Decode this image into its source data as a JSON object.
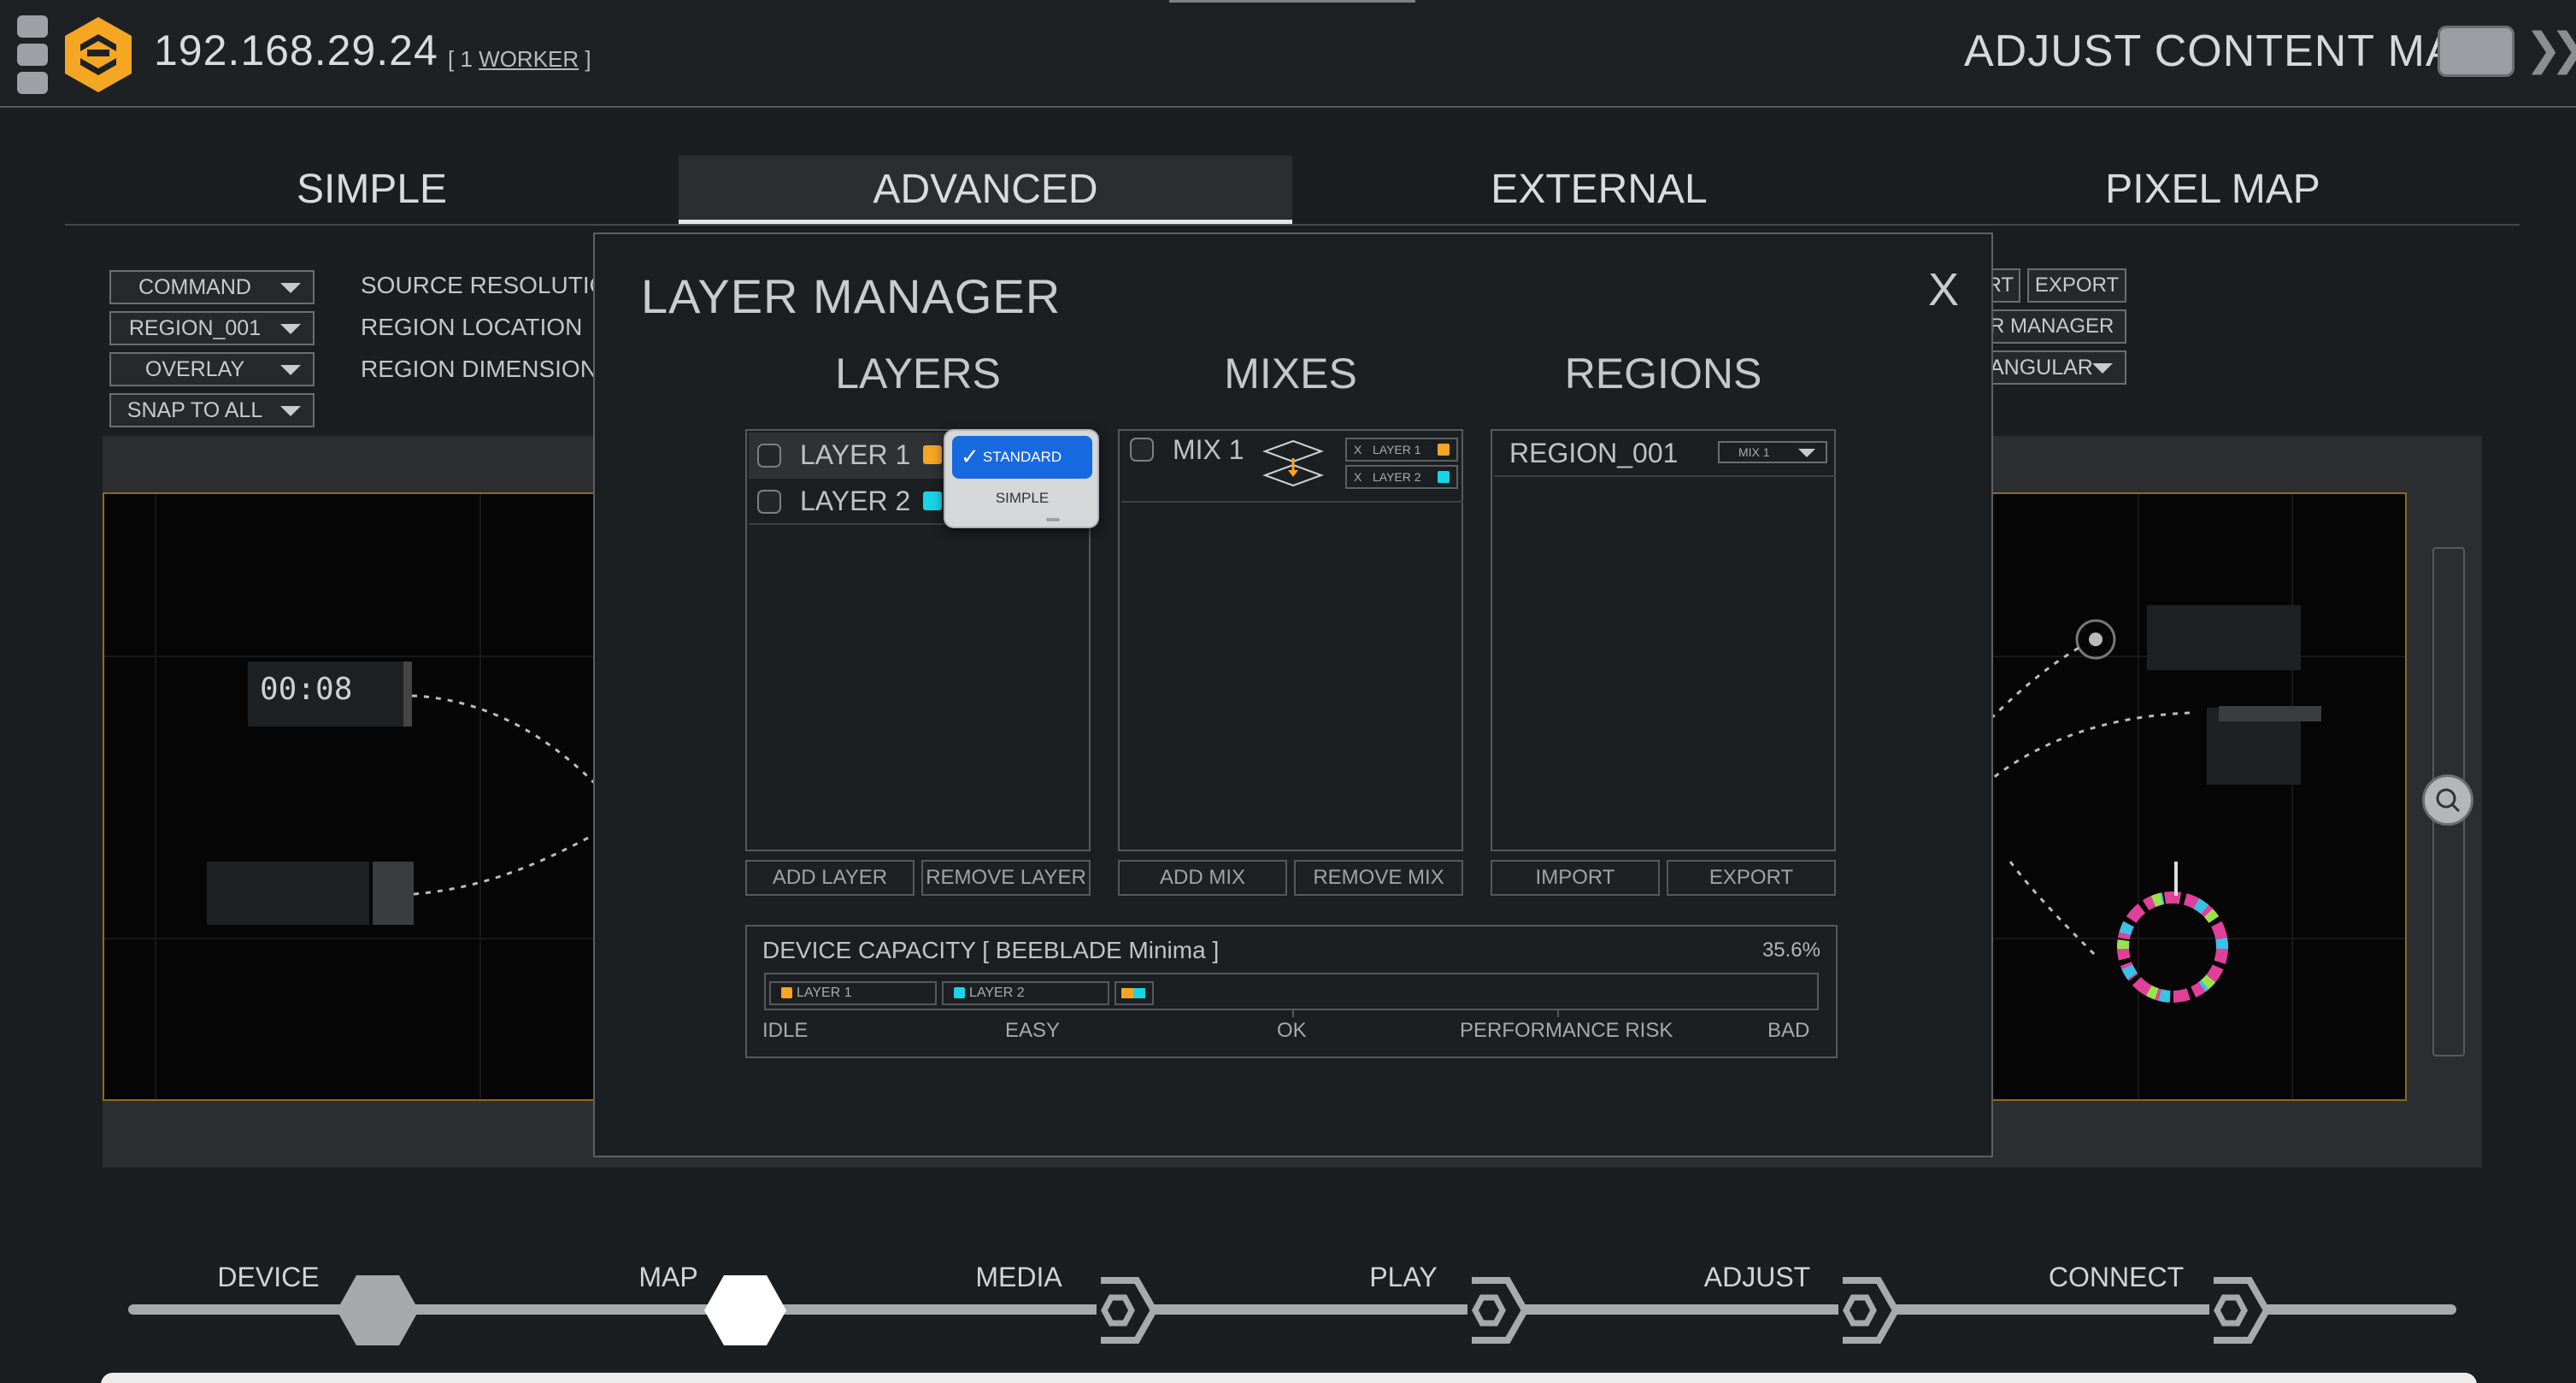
{
  "header": {
    "ip": "192.168.29.24",
    "worker_open": "[ 1",
    "worker_link": "WORKER",
    "worker_close": "]",
    "page_title": "ADJUST CONTENT MAP"
  },
  "mode_tabs": [
    {
      "label": "SIMPLE",
      "active": false
    },
    {
      "label": "ADVANCED",
      "active": true
    },
    {
      "label": "EXTERNAL",
      "active": false
    },
    {
      "label": "PIXEL MAP",
      "active": false
    }
  ],
  "toolbar": {
    "dropdowns": [
      "COMMAND",
      "REGION_001",
      "OVERLAY",
      "SNAP TO ALL"
    ],
    "labels": [
      "SOURCE RESOLUTION",
      "REGION LOCATION",
      "REGION DIMENSIONS"
    ],
    "right_buttons": [
      "RT",
      "EXPORT",
      "R MANAGER",
      "ANGULAR"
    ]
  },
  "canvas": {
    "timer": "00:08",
    "accent_color": "#f2a516"
  },
  "modal": {
    "title": "LAYER MANAGER",
    "close": "X",
    "layers": {
      "heading": "LAYERS",
      "rows": [
        {
          "label": "LAYER 1",
          "color": "#f5a623"
        },
        {
          "label": "LAYER 2",
          "color": "#19d4e6"
        }
      ],
      "add": "ADD LAYER",
      "remove": "REMOVE LAYER"
    },
    "blend_popup": {
      "options": [
        "STANDARD",
        "SIMPLE"
      ],
      "selected": "STANDARD"
    },
    "mixes": {
      "heading": "MIXES",
      "rows": [
        {
          "label": "MIX 1",
          "tags": [
            {
              "x": "X",
              "label": "LAYER 1",
              "color": "#f5a623"
            },
            {
              "x": "X",
              "label": "LAYER 2",
              "color": "#19d4e6"
            }
          ]
        }
      ],
      "add": "ADD MIX",
      "remove": "REMOVE MIX"
    },
    "regions": {
      "heading": "REGIONS",
      "rows": [
        {
          "label": "REGION_001",
          "mix": "MIX 1"
        }
      ],
      "import": "IMPORT",
      "export": "EXPORT"
    },
    "capacity": {
      "title": "DEVICE CAPACITY [ BEEBLADE Minima ]",
      "percent": "35.6%",
      "percent_value": 35.6,
      "chips": [
        {
          "label": "LAYER 1",
          "color": "#f5a623"
        },
        {
          "label": "LAYER 2",
          "color": "#19d4e6"
        }
      ],
      "scale": [
        "IDLE",
        "EASY",
        "OK",
        "PERFORMANCE RISK",
        "BAD"
      ]
    }
  },
  "bottom_nav": {
    "steps": [
      "DEVICE",
      "MAP",
      "MEDIA",
      "PLAY",
      "ADJUST",
      "CONNECT"
    ],
    "current": "MAP"
  },
  "colors": {
    "brand": "#f5a623",
    "selection_blue": "#1769e0"
  }
}
